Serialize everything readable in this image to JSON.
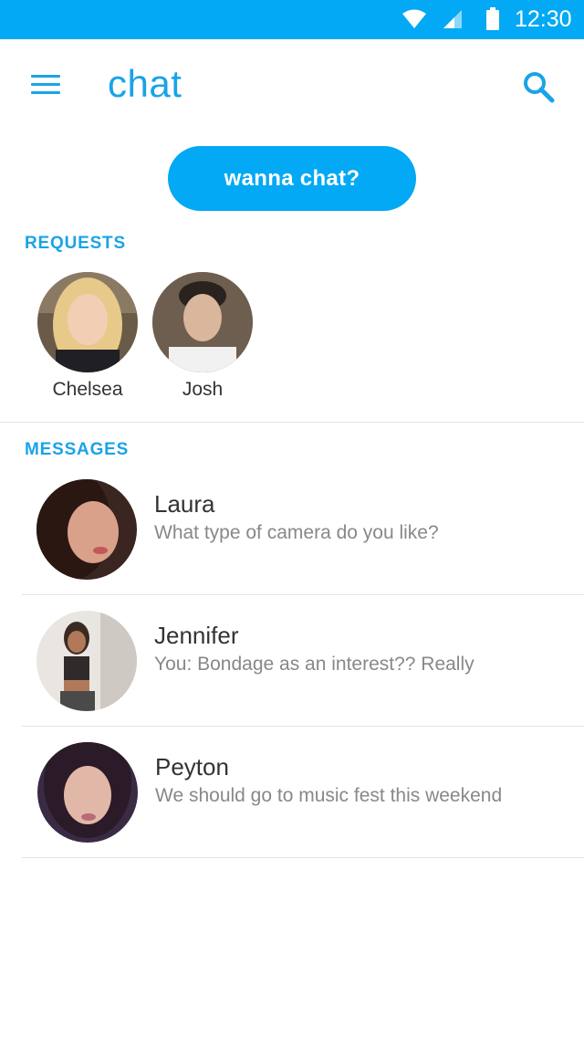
{
  "status_bar": {
    "time": "12:30",
    "icons": [
      "wifi-icon",
      "cell-signal-icon",
      "battery-icon"
    ]
  },
  "app_bar": {
    "title": "chat",
    "menu_icon": "hamburger-menu-icon",
    "search_icon": "search-icon"
  },
  "primary_action": {
    "label": "wanna chat?"
  },
  "requests": {
    "label": "REQUESTS",
    "items": [
      {
        "name": "Chelsea",
        "avatar": "avatar-photo"
      },
      {
        "name": "Josh",
        "avatar": "avatar-photo"
      }
    ]
  },
  "messages": {
    "label": "MESSAGES",
    "items": [
      {
        "name": "Laura",
        "preview": "What type of camera do you like?"
      },
      {
        "name": "Jennifer",
        "preview": "You: Bondage as an interest?? Really"
      },
      {
        "name": "Peyton",
        "preview": "We should go to music fest this weekend"
      }
    ]
  },
  "colors": {
    "accent": "#03a9f4",
    "accent_text": "#1aa3e8",
    "name_text": "#333333",
    "preview_text": "#888888",
    "divider": "#e3e3e3"
  }
}
